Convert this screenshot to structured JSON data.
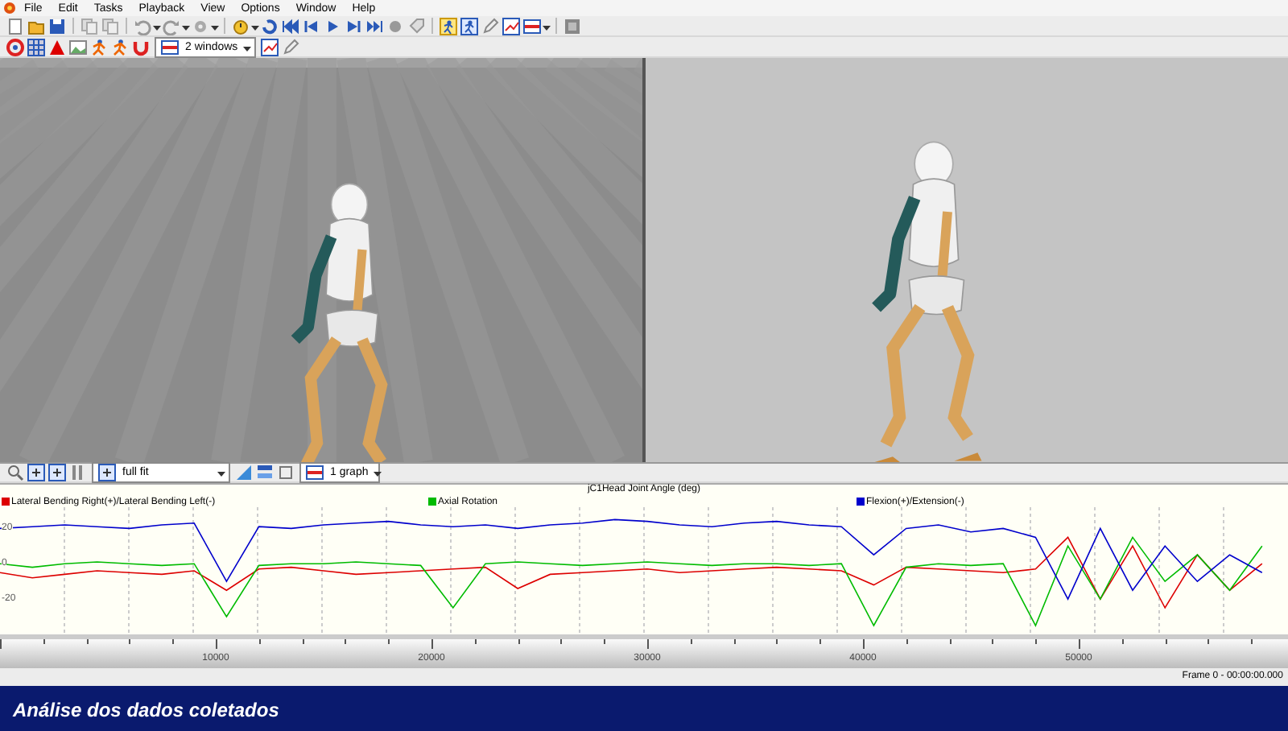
{
  "menu_bar": {
    "items": [
      "File",
      "Edit",
      "Tasks",
      "Playback",
      "View",
      "Options",
      "Window",
      "Help"
    ]
  },
  "view_toolbar": {
    "layout_dropdown": "2 windows"
  },
  "graph_toolbar": {
    "zoom_dropdown": "full fit",
    "graphs_dropdown": "1 graph"
  },
  "graph": {
    "chart_data": {
      "type": "line",
      "title": "jC1Head Joint Angle (deg)",
      "x": [
        0,
        1500,
        3000,
        4500,
        6000,
        7500,
        9000,
        10500,
        12000,
        13500,
        15000,
        16500,
        18000,
        19500,
        21000,
        22500,
        24000,
        25500,
        27000,
        28500,
        30000,
        31500,
        33000,
        34500,
        36000,
        37500,
        39000,
        40500,
        42000,
        43500,
        45000,
        46500,
        48000,
        49500,
        51000,
        52500,
        54000,
        55500,
        57000,
        58500
      ],
      "series": [
        {
          "name": "Lateral Bending Right(+)/Lateral Bending Left(-)",
          "color": "#dd0000",
          "values": [
            -5,
            -8,
            -6,
            -4,
            -5,
            -6,
            -4,
            -15,
            -3,
            -2,
            -4,
            -6,
            -5,
            -4,
            -3,
            -2,
            -14,
            -6,
            -5,
            -4,
            -3,
            -5,
            -4,
            -3,
            -2,
            -3,
            -4,
            -12,
            -2,
            -3,
            -4,
            -5,
            -3,
            15,
            -20,
            10,
            -25,
            5,
            -15,
            0
          ]
        },
        {
          "name": "Axial Rotation",
          "color": "#00bb00",
          "values": [
            0,
            -2,
            0,
            1,
            0,
            -1,
            0,
            -30,
            -1,
            0,
            0,
            1,
            0,
            -1,
            -25,
            0,
            1,
            0,
            -1,
            0,
            1,
            0,
            -1,
            0,
            0,
            -1,
            0,
            -35,
            -2,
            0,
            -1,
            0,
            -35,
            10,
            -20,
            15,
            -10,
            5,
            -15,
            10
          ]
        },
        {
          "name": "Flexion(+)/Extension(-)",
          "color": "#0000cc",
          "values": [
            20,
            21,
            22,
            21,
            20,
            22,
            23,
            -10,
            21,
            20,
            22,
            23,
            24,
            22,
            21,
            22,
            20,
            22,
            23,
            25,
            24,
            22,
            21,
            23,
            24,
            22,
            21,
            5,
            20,
            22,
            18,
            20,
            15,
            -20,
            20,
            -15,
            10,
            -10,
            5,
            -5
          ]
        }
      ],
      "ylim": [
        -40,
        32
      ],
      "yticks": [
        20,
        0,
        -20
      ],
      "xlim": [
        0,
        59700
      ],
      "xticks": [
        10000,
        20000,
        30000,
        40000,
        50000
      ],
      "grid": true
    }
  },
  "status_bar": {
    "frame": "Frame 0 - 00:00:00.000"
  },
  "caption": "Análise dos dados coletados"
}
